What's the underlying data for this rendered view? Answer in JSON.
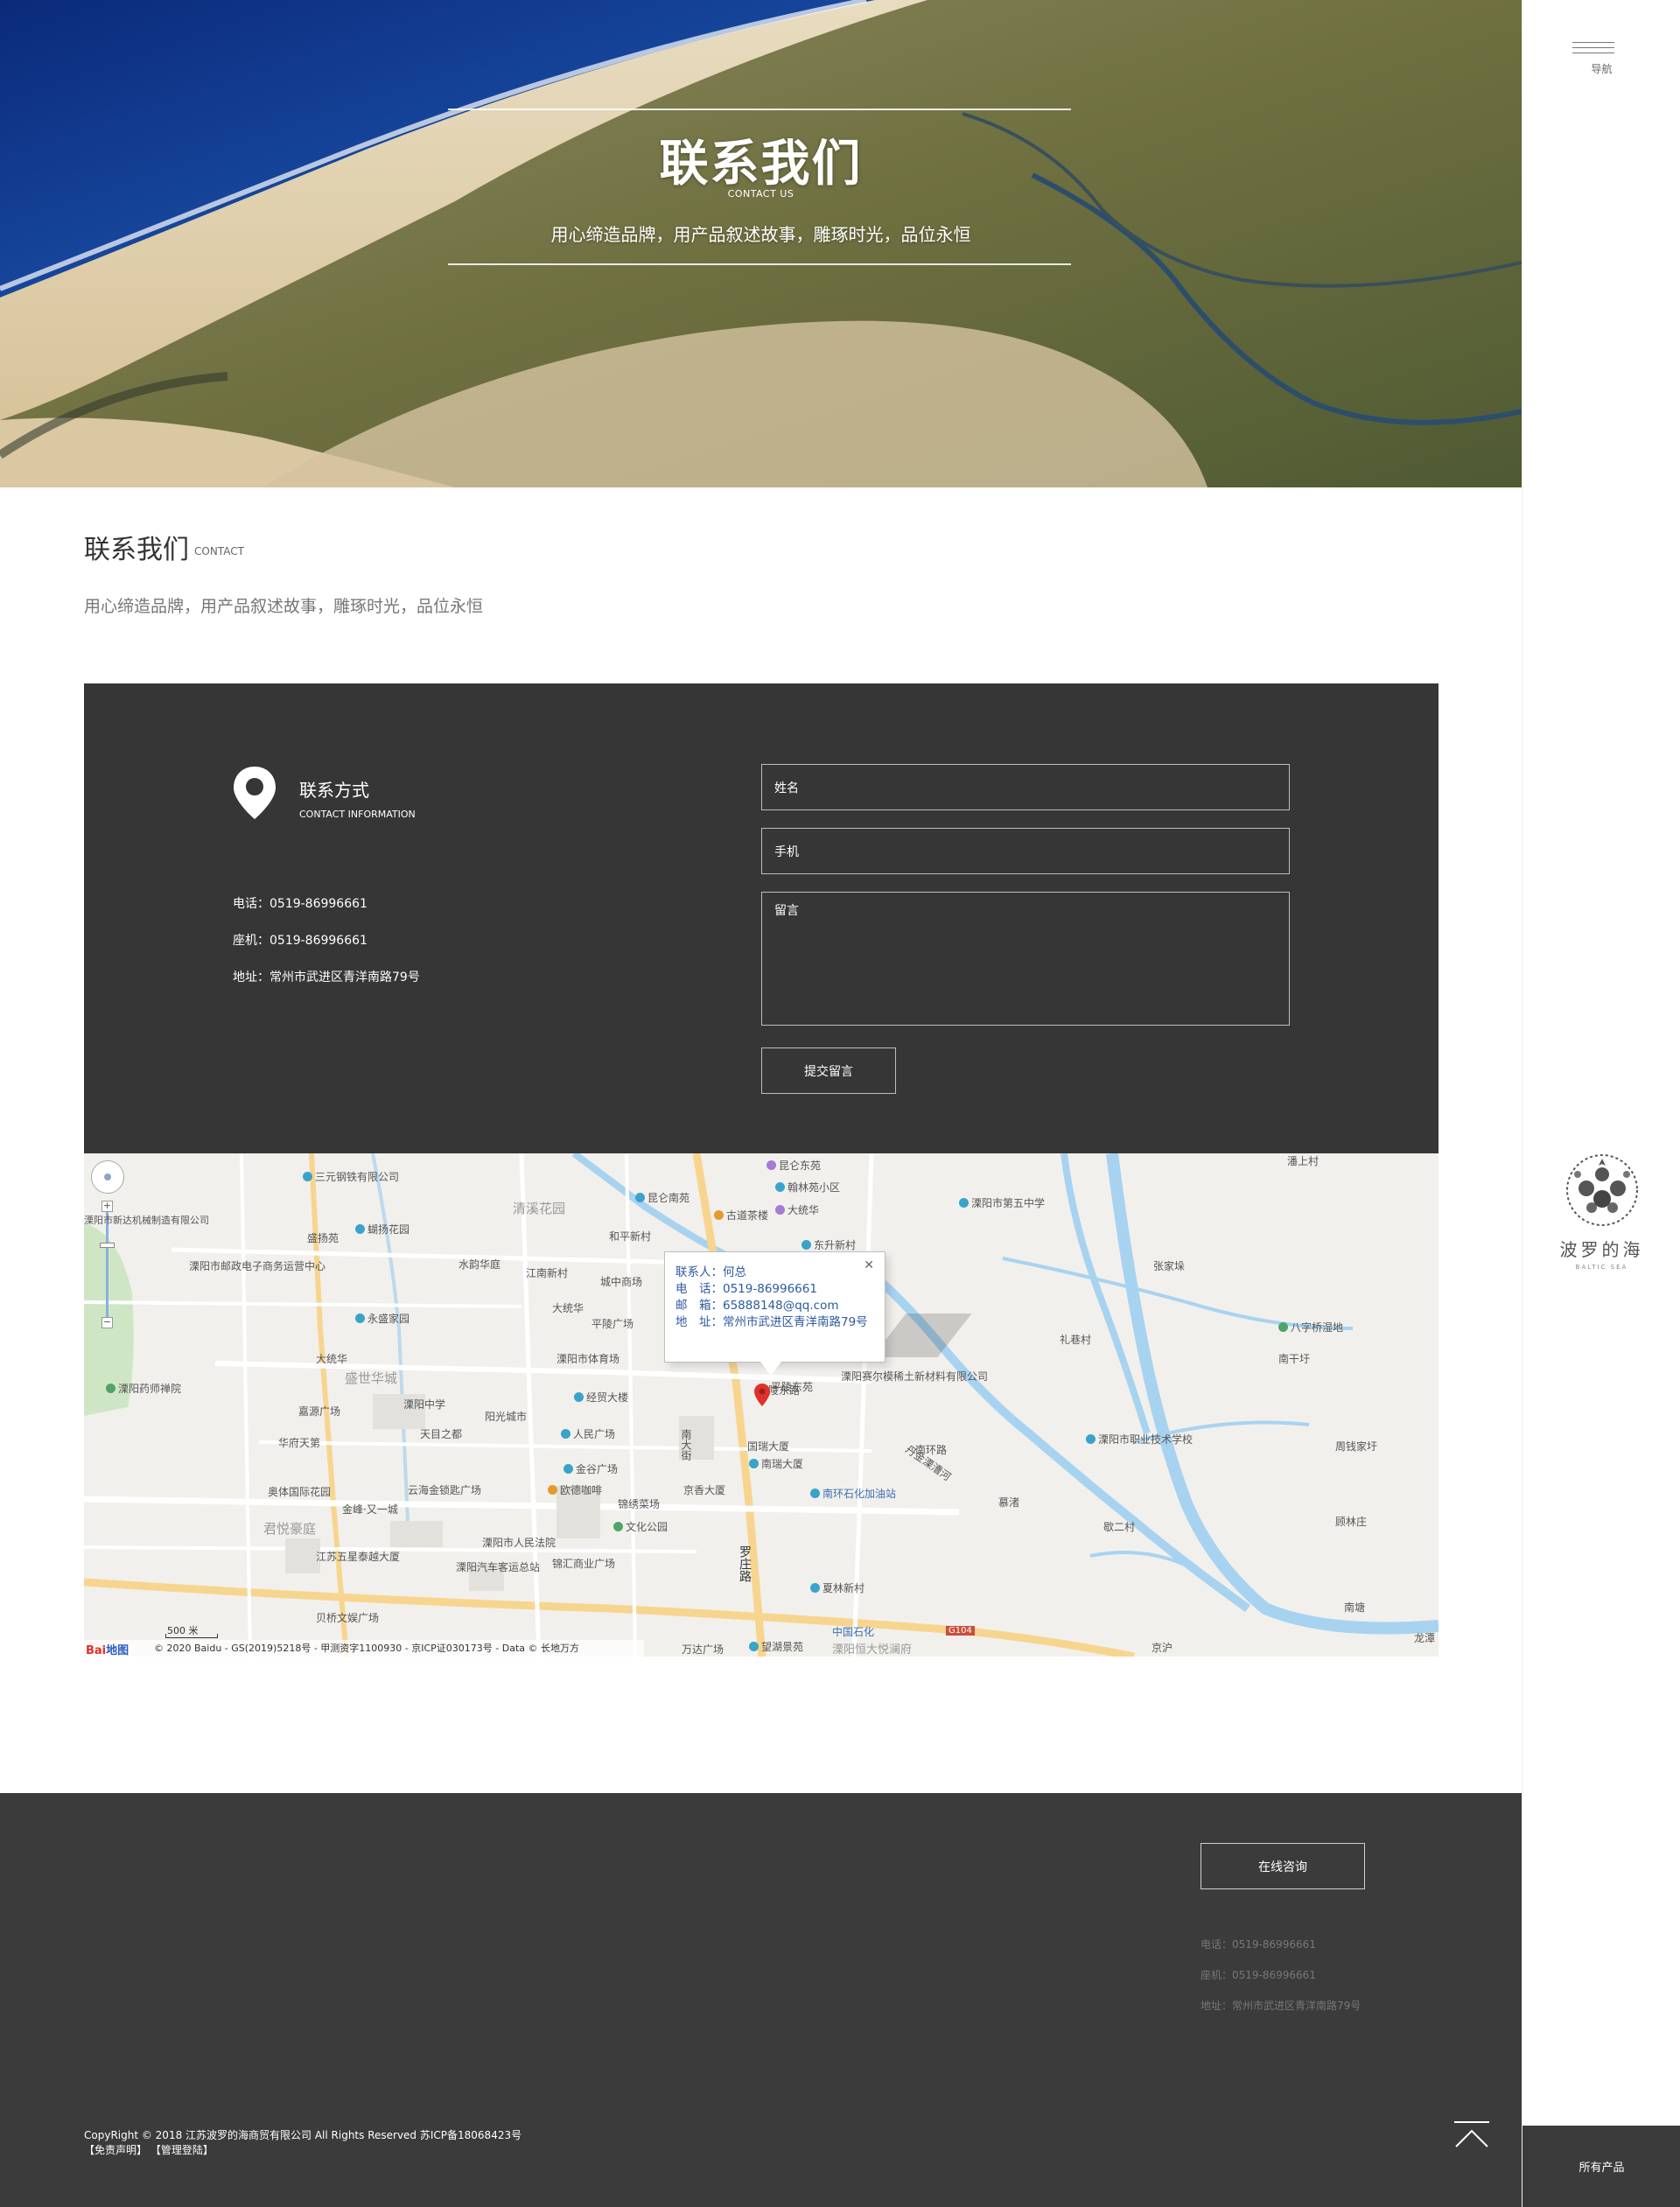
{
  "hero": {
    "title": "联系我们",
    "subtitle": "CONTACT US",
    "slogan": "用心缔造品牌，用产品叙述故事，雕琢时光，品位永恒"
  },
  "sidebar": {
    "menu_label": "导航",
    "menu_icon": "hamburger-icon",
    "logo_cn": "波罗的海",
    "logo_en": "BALTIC SEA",
    "bottom_label": "所有产品"
  },
  "intro": {
    "title": "联系我们",
    "title_en": "CONTACT",
    "desc": "用心缔造品牌，用产品叙述故事，雕琢时光，品位永恒"
  },
  "contact": {
    "icon": "location-pin-icon",
    "heading": "联系方式",
    "heading_en": "CONTACT INFORMATION",
    "phone": "电话：0519-86996661",
    "landline": "座机：0519-86996661",
    "address": "地址：常州市武进区青洋南路79号",
    "form": {
      "name_placeholder": "姓名",
      "mobile_placeholder": "手机",
      "message_placeholder": "留言",
      "submit_label": "提交留言"
    }
  },
  "map": {
    "info": {
      "contact": "联系人：何总",
      "phone": "电　话：0519-86996661",
      "email": "邮　箱：65888148@qq.com",
      "address": "地　址：常州市武进区青洋南路79号"
    },
    "labels": {
      "l1": "三元钢铁有限公司",
      "l2": "溧阳市新达机械制造有限公司",
      "l3": "清溪花园",
      "l4": "昆仑南苑",
      "l5": "昆仑东苑",
      "l6": "翰林苑小区",
      "l7": "大统华",
      "l8": "古道茶楼",
      "l9": "溧阳市第五中学",
      "l10": "盛扬苑",
      "l11": "蝴扬花园",
      "l12": "和平新村",
      "l13": "东升新村",
      "l14": "溧阳市邮政电子商务运营中心",
      "l15": "水韵华庭",
      "l16": "江南新村",
      "l17": "城中商场",
      "l18": "张家垛",
      "l19": "永盛家园",
      "l20": "大统华",
      "l21": "平陵广场",
      "l22": "八字桥湿地",
      "l23": "礼巷村",
      "l24": "大统华",
      "l25": "盛世华城",
      "l26": "溧阳市体育场",
      "l27": "溧阳赛尔模稀土新材料有限公司",
      "l28": "南干圩",
      "l29": "溧阳药师禅院",
      "l30": "溧阳中学",
      "l31": "嘉源广场",
      "l32": "阳光城市",
      "l33": "经贸大楼",
      "l34": "平陵东苑",
      "l35": "溧阳市职业技术学校",
      "l36": "华府天第",
      "l37": "天目之都",
      "l38": "人民广场",
      "l39": "国瑞大厦",
      "l40": "南环路",
      "l41": "周钱家圩",
      "l42": "奥体国际花园",
      "l43": "云海金锁匙广场",
      "l44": "金谷广场",
      "l45": "南瑞大厦",
      "l46": "南环石化加油站",
      "l47": "金峰·又一城",
      "l48": "欧德咖啡",
      "l49": "锦绣菜场",
      "l50": "京香大厦",
      "l51": "君悦豪庭",
      "l52": "文化公园",
      "l53": "慕渚",
      "l54": "歇二村",
      "l55": "溧阳市人民法院",
      "l56": "顾林庄",
      "l57": "江苏五星泰越大厦",
      "l58": "锦汇商业广场",
      "l59": "罗庄路",
      "l60": "平陵东路",
      "l61": "溧阳汽车客运总站",
      "l62": "夏林新村",
      "l63": "南塘",
      "l64": "贝桥文娱广场",
      "l65": "中国石化",
      "l66": "望湖景苑",
      "l67": "万达广场",
      "l68": "溧阳恒大悦澜府",
      "l69": "南大街",
      "l70": "丹金溧漕河",
      "l71": "G104",
      "l72": "京沪",
      "l73": "潘上村",
      "l74": "龙潭"
    },
    "scale": "500 米",
    "copyright": "© 2020 Baidu - GS(2019)5218号 - 甲测资字1100930 - 京ICP证030173号 - Data © 长地万方",
    "brand": "Bai",
    "brand_suffix": "地图"
  },
  "footer": {
    "consult_label": "在线咨询",
    "phone": "电话：0519-86996661",
    "landline": "座机：0519-86996661",
    "address": "地址：常州市武进区青洋南路79号",
    "copyright": "CopyRight © 2018 江苏波罗的海商贸有限公司 All Rights Reserved 苏ICP备18068423号",
    "link_disclaimer": "【免责声明】",
    "link_admin": "【管理登陆】",
    "top_icon": "back-to-top-icon"
  }
}
